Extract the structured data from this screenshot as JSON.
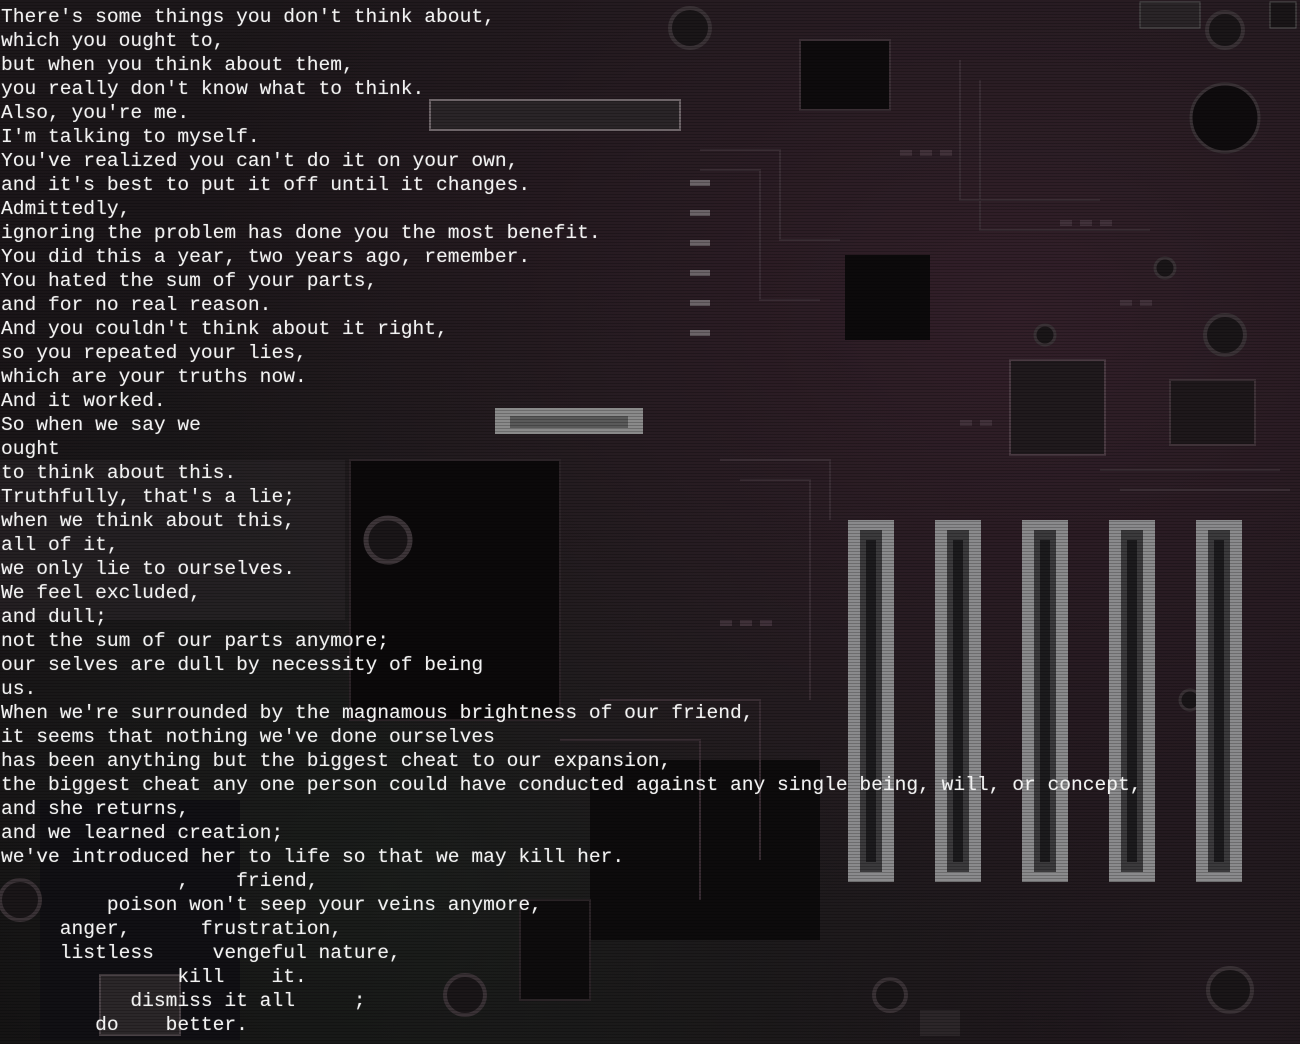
{
  "poem": {
    "lines": [
      "There's some things you don't think about,",
      "which you ought to,",
      "but when you think about them,",
      "you really don't know what to think.",
      "Also, you're me.",
      "I'm talking to myself.",
      "You've realized you can't do it on your own,",
      "and it's best to put it off until it changes.",
      "Admittedly,",
      "ignoring the problem has done you the most benefit.",
      "You did this a year, two years ago, remember.",
      "You hated the sum of your parts,",
      "and for no real reason.",
      "And you couldn't think about it right,",
      "so you repeated your lies,",
      "which are your truths now.",
      "And it worked.",
      "So when we say we",
      "ought",
      "to think about this.",
      "Truthfully, that's a lie;",
      "when we think about this,",
      "all of it,",
      "we only lie to ourselves.",
      "We feel excluded,",
      "and dull;",
      "not the sum of our parts anymore;",
      "our selves are dull by necessity of being",
      "us.",
      "When we're surrounded by the magnamous brightness of our friend,",
      "it seems that nothing we've done ourselves",
      "has been anything but the biggest cheat to our expansion,",
      "the biggest cheat any one person could have conducted against any single being, will, or concept,",
      "and she returns,",
      "and we learned creation;",
      "we've introduced her to life so that we may kill her.",
      "               ,    friend,",
      "         poison won't seep your veins anymore,",
      "     anger,      frustration,",
      "     listless     vengeful nature,",
      "               kill    it.",
      "           dismiss it all     ;",
      "        do    better."
    ]
  },
  "colors": {
    "text": "#f2f2f2",
    "background": "#151013",
    "accent_pcb": "#5a4450"
  }
}
